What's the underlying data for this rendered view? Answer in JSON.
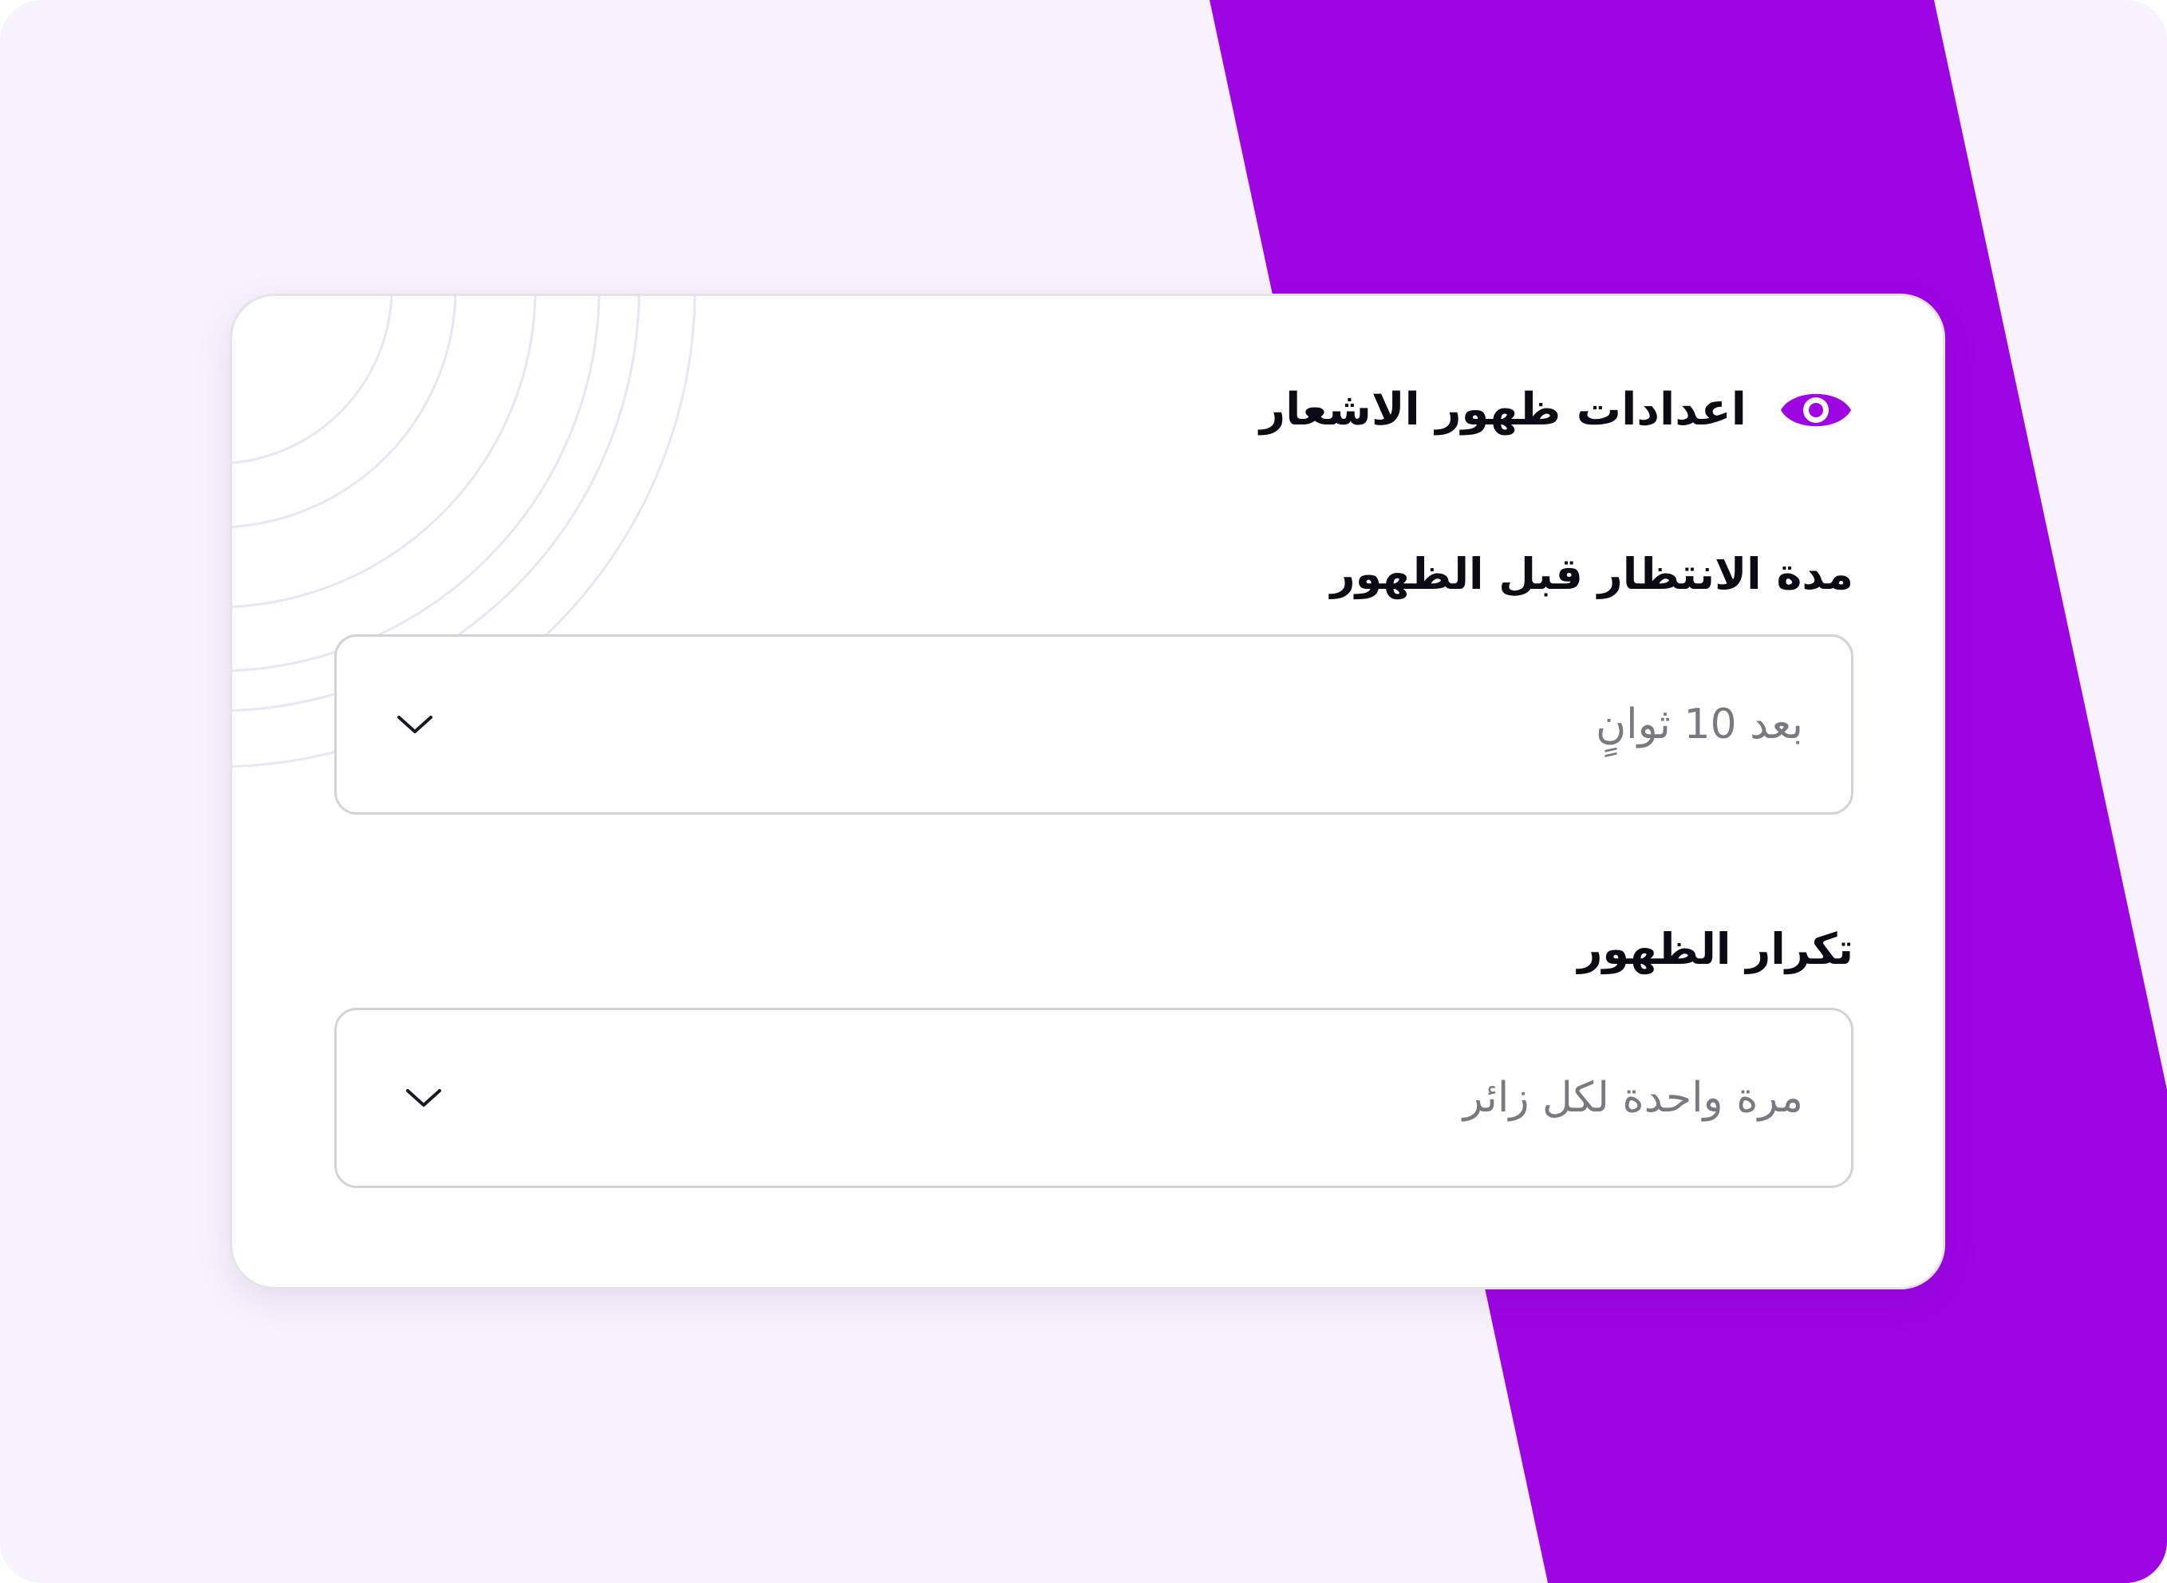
{
  "colors": {
    "background": "#f8f2fe",
    "accent": "#9d05e3",
    "card": "#ffffff",
    "title_text": "#0c0a14",
    "value_text": "#7a7880",
    "border": "#d4d1d9"
  },
  "settings_card": {
    "title": "اعدادات ظهور الاشعار",
    "title_icon": "eye-icon",
    "fields": [
      {
        "label": "مدة الانتظار قبل الظهور",
        "value": "بعد 10 ثوانٍ",
        "icon": "chevron-down-icon"
      },
      {
        "label": "تكرار الظهور",
        "value": "مرة واحدة لكل زائر",
        "icon": "chevron-down-icon"
      }
    ]
  }
}
